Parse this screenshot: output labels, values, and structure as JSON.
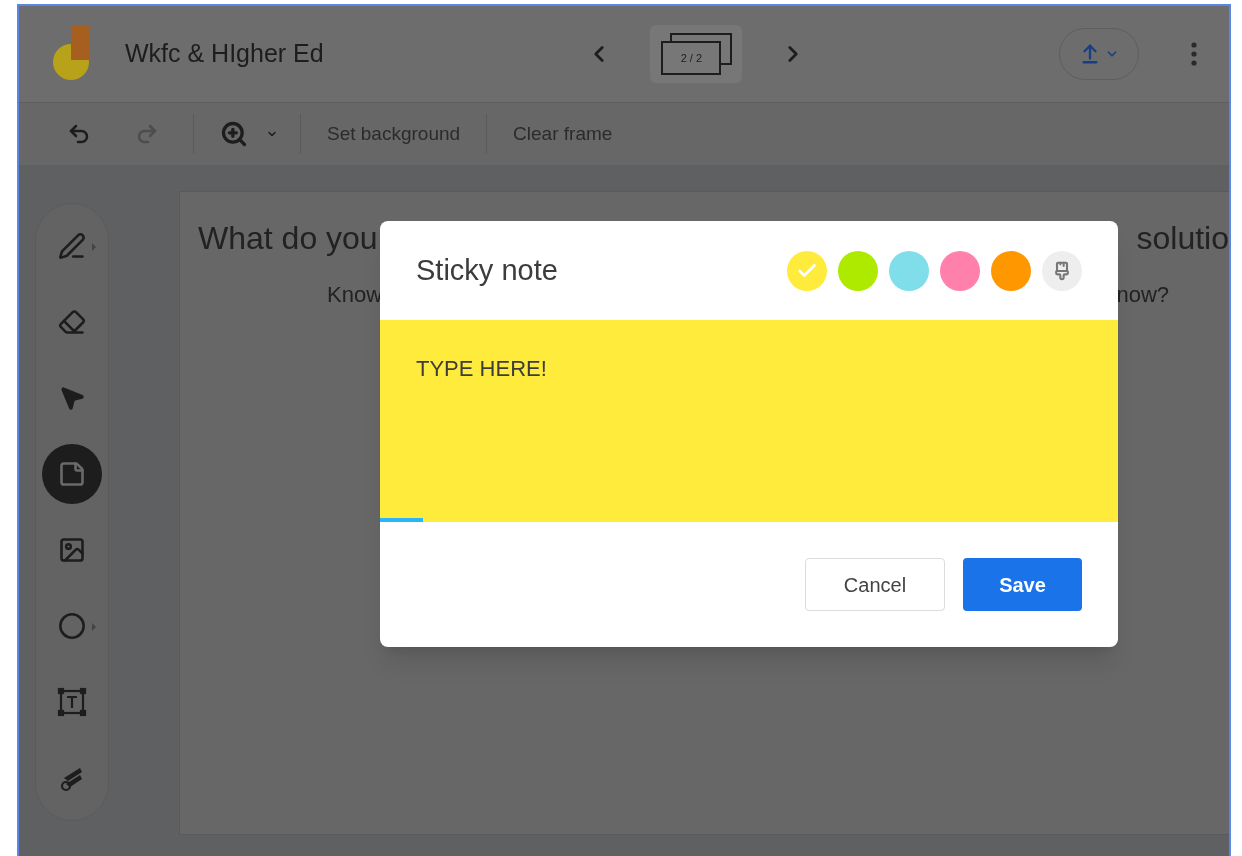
{
  "header": {
    "title": "Wkfc & HIgher Ed",
    "frame_counter": "2 / 2"
  },
  "toolbar": {
    "undo": {
      "disabled": false
    },
    "redo": {
      "disabled": true
    },
    "actions": [
      "Set background",
      "Clear frame"
    ]
  },
  "tools": [
    {
      "kind": "pen",
      "menu": true,
      "selected": false
    },
    {
      "kind": "eraser",
      "menu": false,
      "selected": false
    },
    {
      "kind": "select",
      "menu": false,
      "selected": false
    },
    {
      "kind": "sticky",
      "menu": false,
      "selected": true
    },
    {
      "kind": "image",
      "menu": false,
      "selected": false
    },
    {
      "kind": "circle",
      "menu": true,
      "selected": false
    },
    {
      "kind": "textbox",
      "menu": false,
      "selected": false
    },
    {
      "kind": "laser",
      "menu": false,
      "selected": false
    }
  ],
  "frame": {
    "title_left": "What do you",
    "title_right": "solutio",
    "subtitle_left": "Know",
    "subtitle_right": "now?"
  },
  "dialog": {
    "title": "Sticky note",
    "colors": [
      {
        "color": "#ffeb3b",
        "selected": true,
        "disabled": false
      },
      {
        "color": "#aeea00",
        "selected": false,
        "disabled": false
      },
      {
        "color": "#80deea",
        "selected": false,
        "disabled": false
      },
      {
        "color": "#ff80ab",
        "selected": false,
        "disabled": false
      },
      {
        "color": "#ff9800",
        "selected": false,
        "disabled": false
      },
      {
        "color": "#eeeeee",
        "selected": false,
        "disabled": true
      }
    ],
    "note": {
      "value": "TYPE HERE!"
    },
    "buttons": [
      {
        "kind": "secondary",
        "label": "Cancel"
      },
      {
        "kind": "primary",
        "label": "Save"
      }
    ]
  }
}
